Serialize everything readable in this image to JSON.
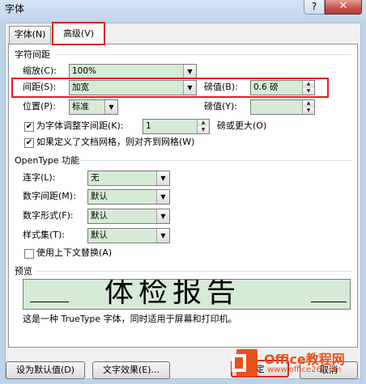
{
  "window": {
    "title": "字体",
    "help_label": "?",
    "close_label": "✕"
  },
  "tabs": [
    {
      "label": "字体(N)"
    },
    {
      "label": "高级(V)"
    }
  ],
  "char_spacing": {
    "section_title": "字符间距",
    "scale": {
      "label": "缩放(C):",
      "value": "100%"
    },
    "spacing": {
      "label": "间距(S):",
      "value": "加宽",
      "by_label": "磅值(B):",
      "by_value": "0.6 磅"
    },
    "position": {
      "label": "位置(P):",
      "value": "标准",
      "by_label": "磅值(Y):",
      "by_value": ""
    },
    "kerning": {
      "label": "为字体调整字间距(K):",
      "value": "1",
      "suffix": "磅或更大(O)",
      "checked": true
    },
    "snap_grid": {
      "label": "如果定义了文档网格，则对齐到网格(W)",
      "checked": true
    }
  },
  "opentype": {
    "section_title": "OpenType 功能",
    "ligatures": {
      "label": "连字(L):",
      "value": "无"
    },
    "number_spacing": {
      "label": "数字间距(M):",
      "value": "默认"
    },
    "number_forms": {
      "label": "数字形式(F):",
      "value": "默认"
    },
    "stylistic_sets": {
      "label": "样式集(T):",
      "value": "默认"
    },
    "contextual_alt": {
      "label": "使用上下文替换(A)",
      "checked": false
    }
  },
  "preview": {
    "section_title": "预览",
    "sample": "体检报告",
    "description": "这是一种 TrueType 字体，同时适用于屏幕和打印机。"
  },
  "buttons": {
    "set_default": "设为默认值(D)",
    "text_effects": "文字效果(E)...",
    "ok": "定",
    "cancel": "取消"
  },
  "watermark": {
    "brand": "Office教程网",
    "url": "www.office26.com"
  },
  "colors": {
    "field_bg": "#d6ebd6",
    "highlight": "#e02020",
    "logo_orange": "#e8501c"
  },
  "icons": {
    "dropdown": "chevron-down-icon",
    "spin": "spin-arrows-icon",
    "check": "checkmark-icon"
  }
}
